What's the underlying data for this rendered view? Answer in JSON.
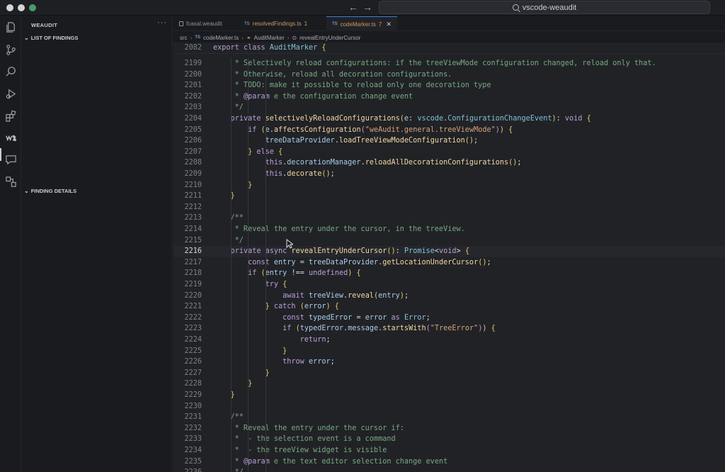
{
  "window": {
    "search_text": "vscode-weaudit"
  },
  "sidebar": {
    "title": "WEAUDIT",
    "more": "···",
    "sections": [
      {
        "label": "LIST OF FINDINGS"
      },
      {
        "label": "FINDING DETAILS"
      }
    ]
  },
  "tabs": [
    {
      "label": "fcasal.weaudit",
      "badge": ""
    },
    {
      "label": "resolvedFindings.ts",
      "badge": "1"
    },
    {
      "label": "codeMarker.ts",
      "badge": "7"
    }
  ],
  "breadcrumb": {
    "folder": "src",
    "file": "codeMarker.ts",
    "class": "AuditMarker",
    "method": "revealEntryUnderCursor"
  },
  "editor": {
    "sticky_line": {
      "num": "2082",
      "text": "export class AuditMarker {"
    },
    "lines": [
      {
        "num": "2199",
        "text": " * Selectively reload configurations: if the treeViewMode configuration changed, reload only that."
      },
      {
        "num": "2200",
        "text": " * Otherwise, reload all decoration configurations."
      },
      {
        "num": "2201",
        "text": " * TODO: make it possible to reload only one decoration type"
      },
      {
        "num": "2202",
        "text": " * @param e the configuration change event"
      },
      {
        "num": "2203",
        "text": " */"
      },
      {
        "num": "2204",
        "text": "private selectivelyReloadConfigurations(e: vscode.ConfigurationChangeEvent): void {"
      },
      {
        "num": "2205",
        "text": "    if (e.affectsConfiguration(\"weAudit.general.treeViewMode\")) {"
      },
      {
        "num": "2206",
        "text": "        treeDataProvider.loadTreeViewModeConfiguration();"
      },
      {
        "num": "2207",
        "text": "    } else {"
      },
      {
        "num": "2208",
        "text": "        this.decorationManager.reloadAllDecorationConfigurations();"
      },
      {
        "num": "2209",
        "text": "        this.decorate();"
      },
      {
        "num": "2210",
        "text": "    }"
      },
      {
        "num": "2211",
        "text": "}"
      },
      {
        "num": "2212",
        "text": ""
      },
      {
        "num": "2213",
        "text": "/**"
      },
      {
        "num": "2214",
        "text": " * Reveal the entry under the cursor, in the treeView."
      },
      {
        "num": "2215",
        "text": " */"
      },
      {
        "num": "2216",
        "text": "private async revealEntryUnderCursor(): Promise<void> {"
      },
      {
        "num": "2217",
        "text": "    const entry = treeDataProvider.getLocationUnderCursor();"
      },
      {
        "num": "2218",
        "text": "    if (entry !== undefined) {"
      },
      {
        "num": "2219",
        "text": "        try {"
      },
      {
        "num": "2220",
        "text": "            await treeView.reveal(entry);"
      },
      {
        "num": "2221",
        "text": "        } catch (error) {"
      },
      {
        "num": "2222",
        "text": "            const typedError = error as Error;"
      },
      {
        "num": "2223",
        "text": "            if (typedError.message.startsWith(\"TreeError\")) {"
      },
      {
        "num": "2224",
        "text": "                return;"
      },
      {
        "num": "2225",
        "text": "            }"
      },
      {
        "num": "2226",
        "text": "            throw error;"
      },
      {
        "num": "2227",
        "text": "        }"
      },
      {
        "num": "2228",
        "text": "    }"
      },
      {
        "num": "2229",
        "text": "}"
      },
      {
        "num": "2230",
        "text": ""
      },
      {
        "num": "2231",
        "text": "/**"
      },
      {
        "num": "2232",
        "text": " * Reveal the entry under the cursor if:"
      },
      {
        "num": "2233",
        "text": " *  - the selection event is a command"
      },
      {
        "num": "2234",
        "text": " *  - the treeView widget is visible"
      },
      {
        "num": "2235",
        "text": " * @param e the text editor selection change event"
      },
      {
        "num": "2236",
        "text": " */"
      }
    ],
    "current_line": "2216"
  },
  "colors": {
    "accent": "#3a7bd5",
    "comment": "#78a982",
    "keyword": "#b9a0d6",
    "function": "#f0d9a2",
    "string": "#d3a37a",
    "type": "#7fc1d8"
  }
}
